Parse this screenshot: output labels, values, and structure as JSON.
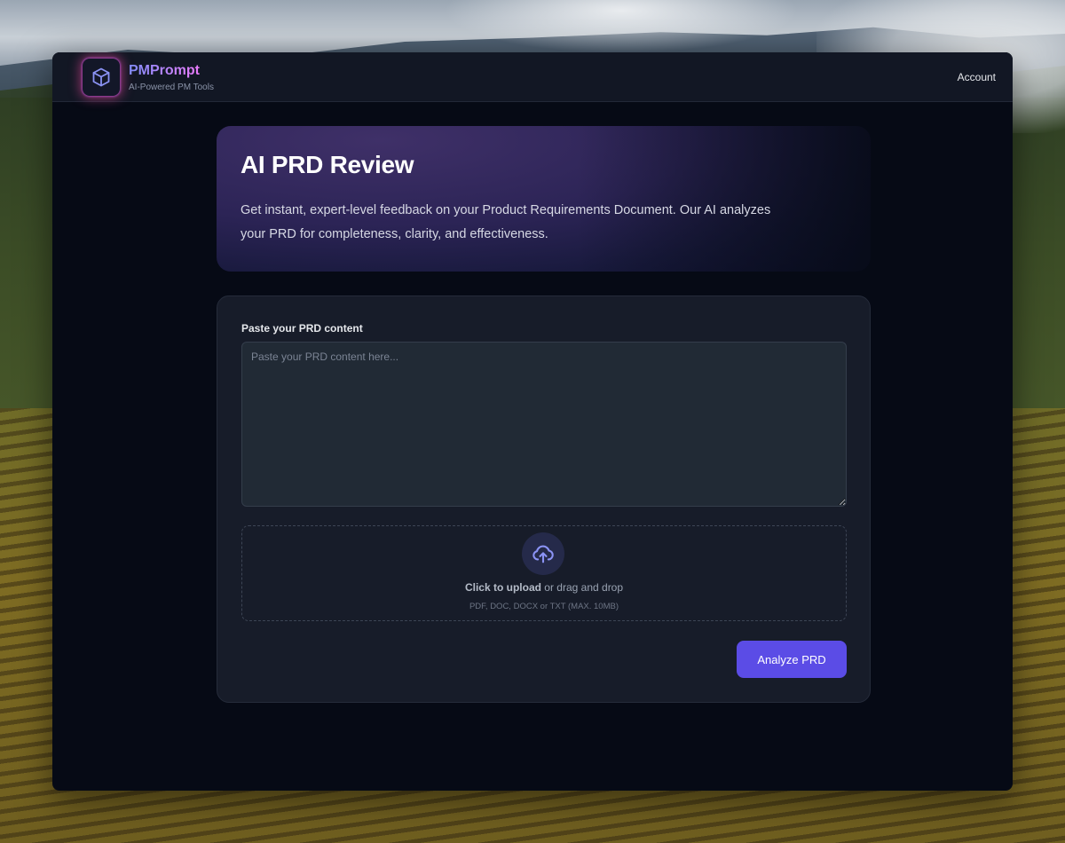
{
  "brand": {
    "name": "PMPrompt",
    "tagline": "AI-Powered PM Tools",
    "logo_icon": "cube-icon"
  },
  "nav": {
    "account_label": "Account"
  },
  "hero": {
    "title": "AI PRD Review",
    "description": "Get instant, expert-level feedback on your Product Requirements Document. Our AI analyzes your PRD for completeness, clarity, and effectiveness."
  },
  "form": {
    "textarea_label": "Paste your PRD content",
    "textarea_value": "",
    "textarea_placeholder": "Paste your PRD content here...",
    "upload": {
      "icon": "cloud-upload-icon",
      "click_label": "Click to upload",
      "drag_label": " or drag and drop",
      "hint": "PDF, DOC, DOCX or TXT (MAX. 10MB)"
    },
    "submit_label": "Analyze PRD"
  },
  "colors": {
    "accent": "#5b4ce6",
    "brand_gradient_start": "#818cf8",
    "brand_gradient_end": "#e879f9",
    "background": "#060a15",
    "card": "#171c29"
  }
}
